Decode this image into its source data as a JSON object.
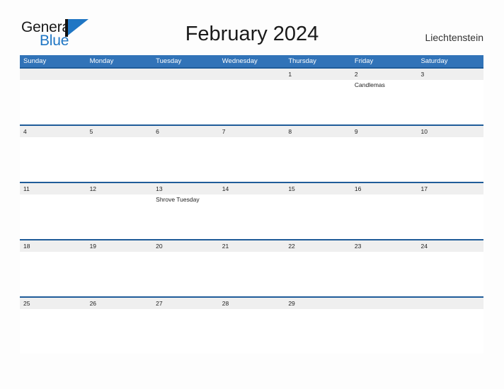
{
  "brand": {
    "name_part1": "General",
    "name_part2": "Blue",
    "accent_color": "#1f76c4"
  },
  "header": {
    "title": "February 2024",
    "country": "Liechtenstein"
  },
  "theme": {
    "header_bar_color": "#3173b8",
    "row_divider_color": "#1f5c99",
    "date_band_color": "#efefef",
    "page_background": "#fdfdfd"
  },
  "calendar": {
    "weekdays": [
      "Sunday",
      "Monday",
      "Tuesday",
      "Wednesday",
      "Thursday",
      "Friday",
      "Saturday"
    ],
    "weeks": [
      {
        "days": [
          {
            "date": "",
            "events": []
          },
          {
            "date": "",
            "events": []
          },
          {
            "date": "",
            "events": []
          },
          {
            "date": "",
            "events": []
          },
          {
            "date": "1",
            "events": []
          },
          {
            "date": "2",
            "events": [
              "Candlemas"
            ]
          },
          {
            "date": "3",
            "events": []
          }
        ]
      },
      {
        "days": [
          {
            "date": "4",
            "events": []
          },
          {
            "date": "5",
            "events": []
          },
          {
            "date": "6",
            "events": []
          },
          {
            "date": "7",
            "events": []
          },
          {
            "date": "8",
            "events": []
          },
          {
            "date": "9",
            "events": []
          },
          {
            "date": "10",
            "events": []
          }
        ]
      },
      {
        "days": [
          {
            "date": "11",
            "events": []
          },
          {
            "date": "12",
            "events": []
          },
          {
            "date": "13",
            "events": [
              "Shrove Tuesday"
            ]
          },
          {
            "date": "14",
            "events": []
          },
          {
            "date": "15",
            "events": []
          },
          {
            "date": "16",
            "events": []
          },
          {
            "date": "17",
            "events": []
          }
        ]
      },
      {
        "days": [
          {
            "date": "18",
            "events": []
          },
          {
            "date": "19",
            "events": []
          },
          {
            "date": "20",
            "events": []
          },
          {
            "date": "21",
            "events": []
          },
          {
            "date": "22",
            "events": []
          },
          {
            "date": "23",
            "events": []
          },
          {
            "date": "24",
            "events": []
          }
        ]
      },
      {
        "days": [
          {
            "date": "25",
            "events": []
          },
          {
            "date": "26",
            "events": []
          },
          {
            "date": "27",
            "events": []
          },
          {
            "date": "28",
            "events": []
          },
          {
            "date": "29",
            "events": []
          },
          {
            "date": "",
            "events": []
          },
          {
            "date": "",
            "events": []
          }
        ]
      }
    ]
  }
}
